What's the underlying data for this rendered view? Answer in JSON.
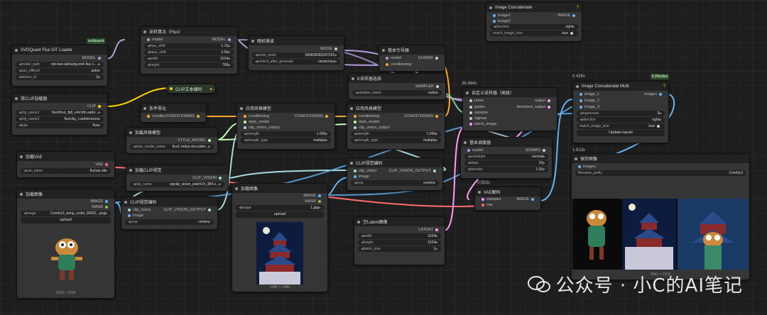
{
  "nodes": {
    "svdquant_loader": {
      "title": "SVDQuant Flux DiT Loader",
      "badge": "svdquant",
      "out": "MODEL",
      "widgets": [
        {
          "k": "model_path",
          "v": "mit-han-lab/svdq-int4-flux.1-..."
        },
        {
          "k": "cpu_offload",
          "v": "auto"
        },
        {
          "k": "device_id",
          "v": "0"
        }
      ]
    },
    "sampling_algo": {
      "title": "采样算法（Flux）",
      "in": "model",
      "out": "MODEL",
      "widgets": [
        {
          "k": "max_shift",
          "v": "1.15"
        },
        {
          "k": "base_shift",
          "v": "0.50"
        },
        {
          "k": "width",
          "v": "1024"
        },
        {
          "k": "height",
          "v": "768"
        }
      ]
    },
    "random_noise": {
      "title": "随机噪波",
      "out": "NOISE",
      "widgets": [
        {
          "k": "noise_seed",
          "v": "366828083187091"
        },
        {
          "k": "control_after_generate",
          "v": "randomize"
        }
      ]
    },
    "basic_guider": {
      "title": "基本引导器",
      "in1": "model",
      "in2": "conditioning",
      "out": "GUIDER"
    },
    "image_concat": {
      "title": "Image Concatenate",
      "in1": "image1",
      "in2": "image2",
      "out": "IMAGE",
      "widgets": [
        {
          "k": "direction",
          "v": "right"
        },
        {
          "k": "match_image_size",
          "v": "true"
        }
      ]
    },
    "dual_clip": {
      "title": "双CLIP加载器",
      "out": "CLIP",
      "widgets": [
        {
          "k": "clip_name1",
          "v": "flux\\t5xxl_fp8_e4m3fn.safet..."
        },
        {
          "k": "clip_name2",
          "v": "flux\\clip_l.safetensors"
        },
        {
          "k": "type",
          "v": "flux"
        }
      ]
    },
    "clip_text": {
      "title": "CLIP文本编码"
    },
    "cond_zero": {
      "title": "条件零化",
      "in": "conditioning",
      "out": "CONDITIONING"
    },
    "style_model1": {
      "title": "应用风格模型",
      "in1": "conditioning",
      "in2": "style_model",
      "in3": "clip_vision_output",
      "out": "CONDITIONING",
      "widgets": [
        {
          "k": "strength",
          "v": "1.000"
        },
        {
          "k": "strength_type",
          "v": "multiply"
        }
      ]
    },
    "ksampler_select": {
      "title": "K采样器选择",
      "out": "SAMPLER",
      "widgets": [
        {
          "k": "sampler_name",
          "v": "euler"
        }
      ]
    },
    "style_model2": {
      "title": "应用风格模型",
      "in1": "conditioning",
      "in2": "style_model",
      "in3": "clip_vision_output",
      "out": "CONDITIONING",
      "widgets": [
        {
          "k": "strength",
          "v": "1.000"
        },
        {
          "k": "strength_type",
          "v": "multiply"
        }
      ]
    },
    "custom_sampler": {
      "title": "自定义采样器（高级）",
      "pct": "36.484s",
      "ins": [
        "noise",
        "guider",
        "sampler",
        "sigmas",
        "latent_image"
      ],
      "outs": [
        "output",
        "denoised_output"
      ]
    },
    "load_style": {
      "title": "加载风格模型",
      "out": "STYLE_MODEL",
      "widgets": [
        {
          "k": "style_model_name",
          "v": "flux1-redux-dev.safet..."
        }
      ]
    },
    "load_vae": {
      "title": "加载VAE",
      "out": "VAE",
      "widgets": [
        {
          "k": "vae_name",
          "v": "flux\\ae.sft"
        }
      ]
    },
    "load_clip_vision": {
      "title": "加载CLIP视觉",
      "out": "CLIP_VISION",
      "widgets": [
        {
          "k": "clip_name",
          "v": "sigclip_vision_patch14_384.s..."
        }
      ]
    },
    "clip_vision_enc2": {
      "title": "CLIP视觉编码",
      "in1": "clip_vision",
      "in2": "image",
      "out": "CLIP_VISION_OUTPUT",
      "widgets": [
        {
          "k": "crop",
          "v": "center"
        }
      ]
    },
    "basic_scheduler": {
      "title": "基本调度器",
      "in": "model",
      "out": "SIGMAS",
      "widgets": [
        {
          "k": "scheduler",
          "v": "normal"
        },
        {
          "k": "steps",
          "v": "20"
        },
        {
          "k": "denoise",
          "v": "1.00"
        }
      ]
    },
    "load_image1": {
      "title": "加载图像",
      "out1": "IMAGE",
      "out2": "MASK",
      "widgets": [
        {
          "k": "image",
          "v": "ComfyUI_temp_xcdel_00002_.png"
        }
      ],
      "upload": "upload",
      "size": "1526 × 2293"
    },
    "clip_vision_enc1": {
      "title": "CLIP视觉编码",
      "in1": "clip_vision",
      "in2": "image",
      "out": "CLIP_VISION_OUTPUT",
      "widgets": [
        {
          "k": "crop",
          "v": "center"
        }
      ]
    },
    "load_image2": {
      "title": "加载图像",
      "out1": "IMAGE",
      "out2": "MASK",
      "widgets": [
        {
          "k": "image",
          "v": "1.jpg"
        }
      ],
      "upload": "upload",
      "size": "1080 × 1440"
    },
    "empty_latent": {
      "title": "空Latent图像",
      "out": "LATENT",
      "widgets": [
        {
          "k": "width",
          "v": "1024"
        },
        {
          "k": "height",
          "v": "1024"
        },
        {
          "k": "batch_size",
          "v": "1"
        }
      ]
    },
    "vae_decode": {
      "title": "VAE解码",
      "pct": "0.553s",
      "in1": "samples",
      "in2": "vae",
      "out": "IMAGE"
    },
    "image_concat_multi": {
      "title": "Image Concatenate Multi",
      "badge": "KJNodes",
      "pct": "0.426s",
      "in1": "image_1",
      "in2": "image_2",
      "in3": "image_3",
      "out": "images",
      "widgets": [
        {
          "k": "inputcount",
          "v": "3"
        },
        {
          "k": "direction",
          "v": "right"
        },
        {
          "k": "match_image_size",
          "v": "true"
        }
      ],
      "button": "Update inputs"
    },
    "save_image": {
      "title": "保存图像",
      "pct": "1.613s",
      "in": "images",
      "widgets": [
        {
          "k": "filename_prefix",
          "v": "ComfyUI"
        }
      ],
      "size": "5541 × 2293"
    }
  },
  "watermark": "公众号 · 小C的AI笔记",
  "colors": {
    "model": "#b39ddb",
    "clip": "#ffd500",
    "conditioning": "#ffa931",
    "clip_vision": "#a8dadc",
    "image": "#64b5f6",
    "vae": "#ff6e6e",
    "latent": "#ff9cf9",
    "style": "#c2ffae"
  }
}
